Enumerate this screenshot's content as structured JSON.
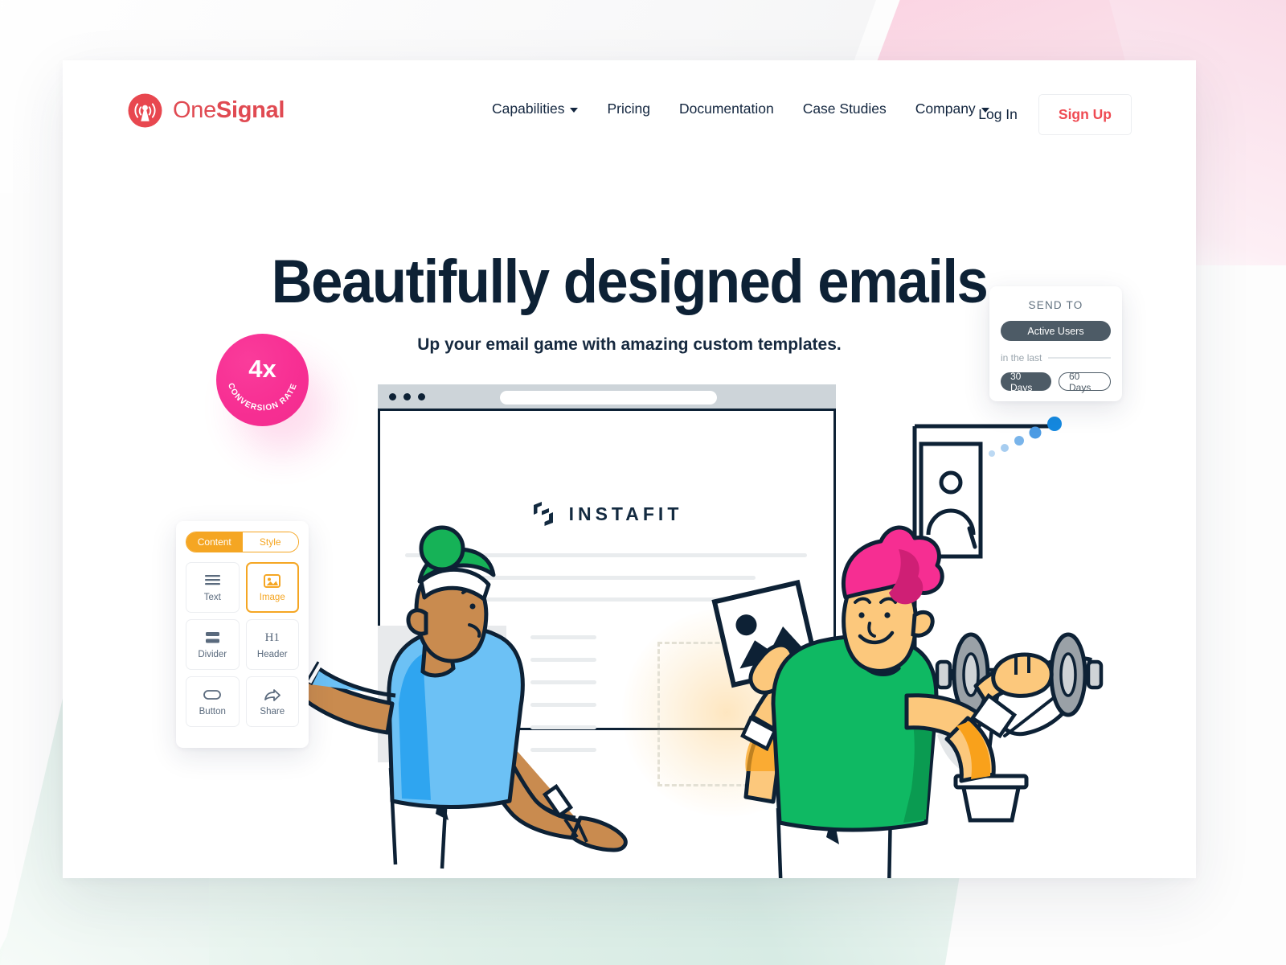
{
  "brand": {
    "logo_icon": "onesignal-signal-tower-icon",
    "name_light": "One",
    "name_bold": "Signal",
    "color": "#e8474f"
  },
  "nav": {
    "items": [
      {
        "label": "Capabilities",
        "has_caret": true
      },
      {
        "label": "Pricing",
        "has_caret": false
      },
      {
        "label": "Documentation",
        "has_caret": false
      },
      {
        "label": "Case Studies",
        "has_caret": false
      },
      {
        "label": "Company",
        "has_caret": true
      }
    ]
  },
  "auth": {
    "login_label": "Log In",
    "signup_label": "Sign Up",
    "signup_color": "#ef4a52"
  },
  "hero": {
    "title": "Beautifully designed emails",
    "subtitle": "Up your email game with amazing custom templates.",
    "title_color": "#0d2135"
  },
  "badge": {
    "value": "4x",
    "caption": "CONVERSION RATE",
    "color": "#f72f93"
  },
  "editor": {
    "tabs": [
      {
        "label": "Content",
        "active": true
      },
      {
        "label": "Style",
        "active": false
      }
    ],
    "accent_color": "#f5a623",
    "blocks": [
      {
        "label": "Text",
        "icon": "text-lines-icon",
        "selected": false
      },
      {
        "label": "Image",
        "icon": "image-icon",
        "selected": true
      },
      {
        "label": "Divider",
        "icon": "divider-icon",
        "selected": false
      },
      {
        "label": "Header",
        "icon": "h1-icon",
        "icon_text": "H1",
        "selected": false
      },
      {
        "label": "Button",
        "icon": "button-pill-icon",
        "selected": false
      },
      {
        "label": "Share",
        "icon": "share-arrow-icon",
        "selected": false
      }
    ]
  },
  "browser": {
    "traffic_lights": 3,
    "url_value": "",
    "logo_mark": "instafit-mark-icon",
    "logo_word": "INSTAFIT"
  },
  "send_to": {
    "title": "SEND TO",
    "audience": "Active Users",
    "in_the_last_label": "in the last",
    "ranges": [
      {
        "label": "30 Days",
        "selected": true
      },
      {
        "label": "60 Days",
        "selected": false
      }
    ],
    "fill_color": "#4d5b66"
  },
  "illustration": {
    "left_person": {
      "hair_color": "#16b257",
      "shirt_color": "#6cc1f5",
      "skin_color": "#c98b4f"
    },
    "right_person": {
      "hair_color": "#f62e92",
      "shirt_color": "#0fb963",
      "skin_color": "#fcc87c"
    },
    "props": [
      "dumbbell",
      "potted-plant",
      "wall-portrait-frame",
      "dragged-image-card"
    ]
  },
  "background": {
    "pink": "#fadfe9",
    "green": "#dfefe8"
  }
}
